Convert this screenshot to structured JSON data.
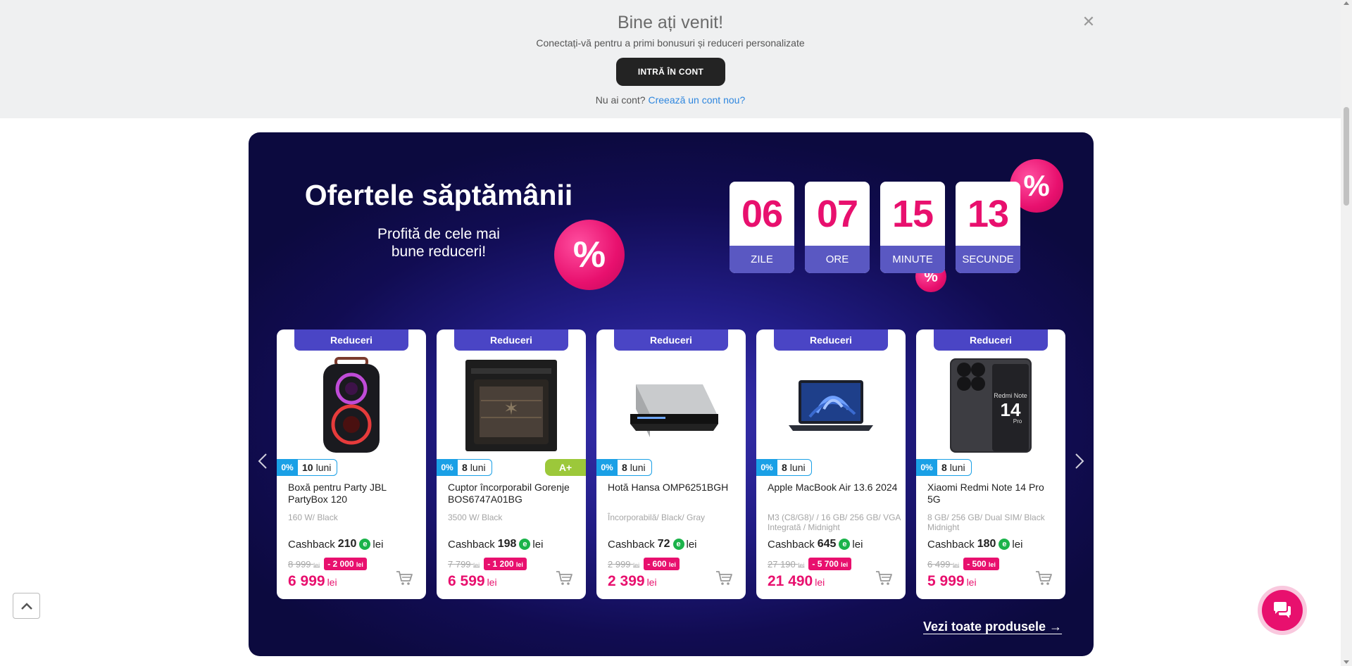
{
  "banner": {
    "title": "Bine ați venit!",
    "subtitle": "Conectați-vă pentru a primi bonusuri și reduceri personalizate",
    "login_button": "INTRĂ ÎN CONT",
    "no_account": "Nu ai cont?",
    "create_account_link": "Creează un cont nou?",
    "close_icon": "close-icon"
  },
  "promo": {
    "title": "Ofertele săptămânii",
    "subtitle": "Profită de cele mai bune reduceri!",
    "percent_symbol": "%",
    "countdown": [
      {
        "value": "06",
        "label": "ZILE"
      },
      {
        "value": "07",
        "label": "ORE"
      },
      {
        "value": "15",
        "label": "MINUTE"
      },
      {
        "value": "13",
        "label": "SECUNDE"
      }
    ],
    "see_all": "Vezi toate produsele →",
    "accent_color": "#e8106e",
    "badge_color": "#4a45c5"
  },
  "products": [
    {
      "badge": "Reduceri",
      "installment_rate": "0%",
      "installment_count": "10",
      "installment_unit": "luni",
      "energy_class": "",
      "name": "Boxă pentru Party JBL PartyBox 120",
      "spec": "160 W/ Black",
      "cashback_label": "Cashback",
      "cashback_value": "210",
      "cashback_currency": "lei",
      "old_price": "8 999",
      "old_currency": "lei",
      "discount": "- 2 000",
      "discount_currency": "lei",
      "price": "6 999",
      "price_currency": "lei",
      "image": "speaker"
    },
    {
      "badge": "Reduceri",
      "installment_rate": "0%",
      "installment_count": "8",
      "installment_unit": "luni",
      "energy_class": "A+",
      "name": "Cuptor încorporabil Gorenje BOS6747A01BG",
      "spec": "3500 W/ Black",
      "cashback_label": "Cashback",
      "cashback_value": "198",
      "cashback_currency": "lei",
      "old_price": "7 799",
      "old_currency": "lei",
      "discount": "- 1 200",
      "discount_currency": "lei",
      "price": "6 599",
      "price_currency": "lei",
      "image": "oven"
    },
    {
      "badge": "Reduceri",
      "installment_rate": "0%",
      "installment_count": "8",
      "installment_unit": "luni",
      "energy_class": "",
      "name": "Hotă Hansa OMP6251BGH",
      "spec": "Încorporabilă/ Black/ Gray",
      "cashback_label": "Cashback",
      "cashback_value": "72",
      "cashback_currency": "lei",
      "old_price": "2 999",
      "old_currency": "lei",
      "discount": "- 600",
      "discount_currency": "lei",
      "price": "2 399",
      "price_currency": "lei",
      "image": "hood"
    },
    {
      "badge": "Reduceri",
      "installment_rate": "0%",
      "installment_count": "8",
      "installment_unit": "luni",
      "energy_class": "",
      "name": "Apple MacBook Air 13.6 2024",
      "spec": "M3 (C8/G8)/ / 16 GB/ 256 GB/ VGA Integrată / Midnight",
      "cashback_label": "Cashback",
      "cashback_value": "645",
      "cashback_currency": "lei",
      "old_price": "27 190",
      "old_currency": "lei",
      "discount": "- 5 700",
      "discount_currency": "lei",
      "price": "21 490",
      "price_currency": "lei",
      "image": "laptop"
    },
    {
      "badge": "Reduceri",
      "installment_rate": "0%",
      "installment_count": "8",
      "installment_unit": "luni",
      "energy_class": "",
      "name": "Xiaomi Redmi Note 14 Pro 5G",
      "spec": "8 GB/ 256 GB/ Dual SIM/ Black Midnight",
      "cashback_label": "Cashback",
      "cashback_value": "180",
      "cashback_currency": "lei",
      "old_price": "6 499",
      "old_currency": "lei",
      "discount": "- 500",
      "discount_currency": "lei",
      "price": "5 999",
      "price_currency": "lei",
      "image": "phone",
      "image_text": "Redmi Note 14 Pro"
    }
  ],
  "icons": {
    "cart": "cart-icon",
    "prev": "chevron-left-icon",
    "next": "chevron-right-icon",
    "back_to_top": "chevron-up-icon",
    "chat": "chat-icon",
    "cashback_coin": "e"
  }
}
